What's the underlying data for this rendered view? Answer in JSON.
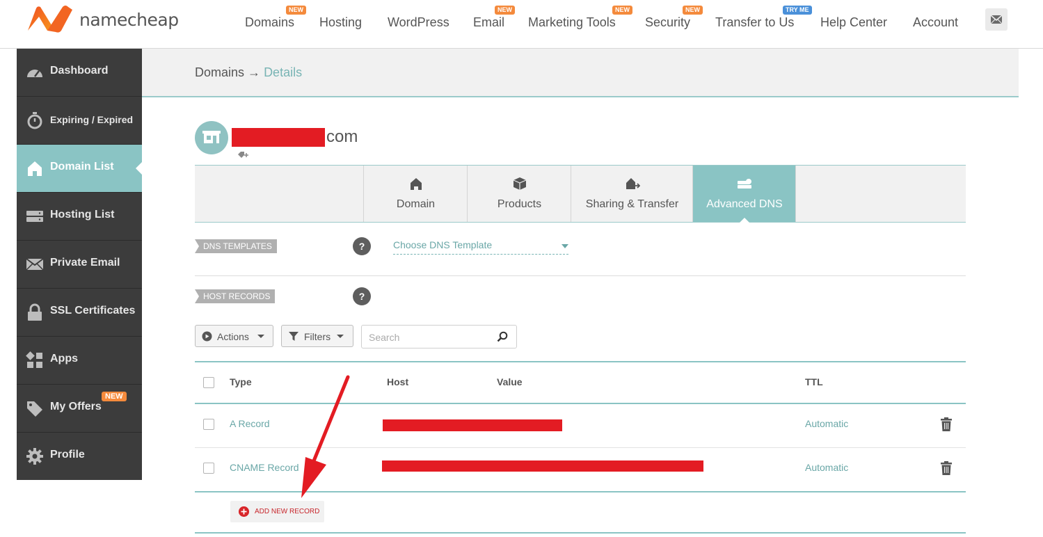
{
  "brand": {
    "name": "namecheap"
  },
  "nav": {
    "items": [
      {
        "label": "Domains",
        "badge": "NEW"
      },
      {
        "label": "Hosting",
        "badge": ""
      },
      {
        "label": "WordPress",
        "badge": ""
      },
      {
        "label": "Email",
        "badge": "NEW"
      },
      {
        "label": "Marketing Tools",
        "badge": "NEW"
      },
      {
        "label": "Security",
        "badge": "NEW"
      },
      {
        "label": "Transfer to Us",
        "badge": "TRY ME"
      },
      {
        "label": "Help Center",
        "badge": ""
      },
      {
        "label": "Account",
        "badge": ""
      }
    ],
    "mail_icon": "envelope-icon"
  },
  "sidebar": {
    "items": [
      {
        "label": "Dashboard",
        "icon": "speedometer-icon"
      },
      {
        "label": "Expiring / Expired",
        "icon": "stopwatch-icon"
      },
      {
        "label": "Domain List",
        "icon": "house-icon",
        "active": true
      },
      {
        "label": "Hosting List",
        "icon": "server-icon"
      },
      {
        "label": "Private Email",
        "icon": "envelope-icon"
      },
      {
        "label": "SSL Certificates",
        "icon": "lock-icon"
      },
      {
        "label": "Apps",
        "icon": "apps-grid-icon"
      },
      {
        "label": "My Offers",
        "icon": "tag-icon",
        "badge": "NEW"
      },
      {
        "label": "Profile",
        "icon": "gear-icon"
      }
    ]
  },
  "breadcrumb": {
    "root": "Domains",
    "separator": "→",
    "current": "Details"
  },
  "domain": {
    "name_suffix": "com",
    "name_redacted": true
  },
  "tabs": [
    {
      "label": "Domain",
      "icon": "house-icon"
    },
    {
      "label": "Products",
      "icon": "box-icon"
    },
    {
      "label": "Sharing & Transfer",
      "icon": "house-arrow-icon"
    },
    {
      "label": "Advanced DNS",
      "icon": "dns-server-icon",
      "active": true
    }
  ],
  "dns_templates": {
    "section_label": "DNS TEMPLATES",
    "help": "?",
    "select_value": "Choose DNS Template"
  },
  "host_records": {
    "section_label": "HOST RECORDS",
    "help": "?",
    "actions_label": "Actions",
    "filters_label": "Filters",
    "search_placeholder": "Search",
    "columns": {
      "type": "Type",
      "host": "Host",
      "value": "Value",
      "ttl": "TTL"
    },
    "rows": [
      {
        "type": "A Record",
        "ttl": "Automatic",
        "host_value_redacted": true
      },
      {
        "type": "CNAME Record",
        "ttl": "Automatic",
        "host_value_redacted": true
      }
    ],
    "add_label": "ADD NEW RECORD"
  },
  "colors": {
    "accent_teal": "#8ac4c4",
    "link_teal": "#6aa7a7",
    "sidebar_bg": "#3c3c3c",
    "badge_orange": "#f48a3c",
    "badge_blue": "#4a90d9",
    "redaction_red": "#e31c23"
  }
}
